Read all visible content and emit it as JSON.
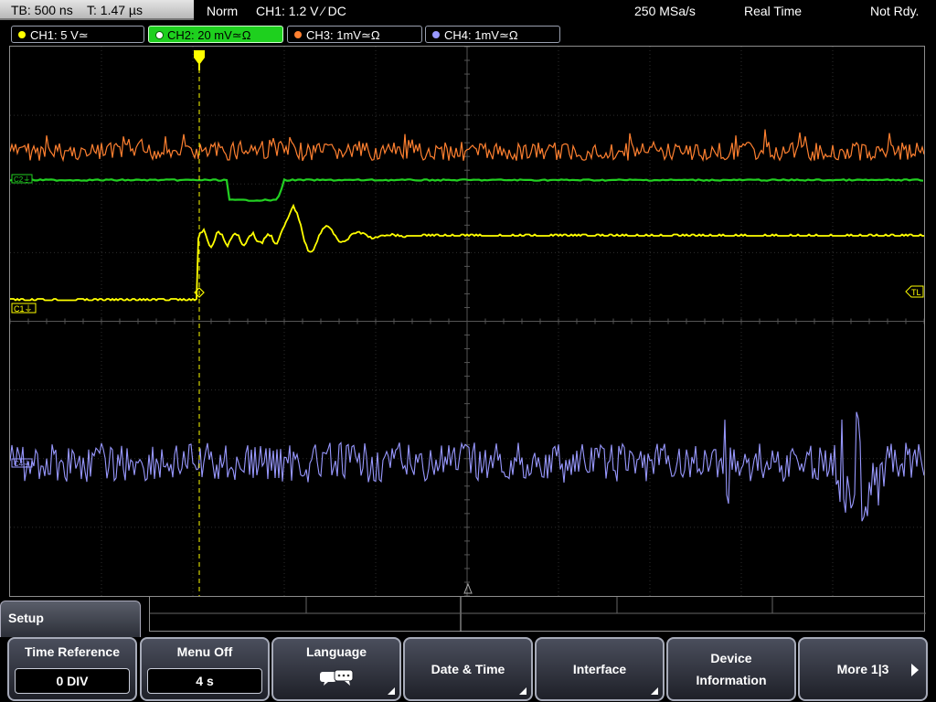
{
  "status_bar": {
    "timebase": "TB: 500 ns",
    "trigger_time": "T: 1.47 µs",
    "mode": "Norm",
    "trigger_source": "CH1: 1.2 V ⁄ DC",
    "sample_rate": "250 MSa/s",
    "acq_mode": "Real Time",
    "state": "Not Rdy."
  },
  "channels": [
    {
      "label": "CH1: 5 V≃",
      "color": "#ffff00",
      "active": false
    },
    {
      "label": "CH2: 20 mV≃Ω",
      "color": "#22d022",
      "active": true
    },
    {
      "label": "CH3: 1mV≃Ω",
      "color": "#ff8030",
      "active": false
    },
    {
      "label": "CH4: 1mV≃Ω",
      "color": "#9898ff",
      "active": false
    }
  ],
  "markers": {
    "ch1_ground": "C1⏚",
    "trigger_level": "TL",
    "ch2": "C2⏚",
    "ch4": "C4⏚"
  },
  "menu": {
    "title": "Setup",
    "softkeys": [
      {
        "label": "Time Reference",
        "value": "0 DIV"
      },
      {
        "label": "Menu Off",
        "value": "4 s"
      },
      {
        "label": "Language",
        "icon": "speech-bubbles-icon"
      },
      {
        "label": "Date & Time"
      },
      {
        "label": "Interface"
      },
      {
        "label_line1": "Device",
        "label_line2": "Information"
      },
      {
        "label": "More 1|3"
      }
    ]
  }
}
